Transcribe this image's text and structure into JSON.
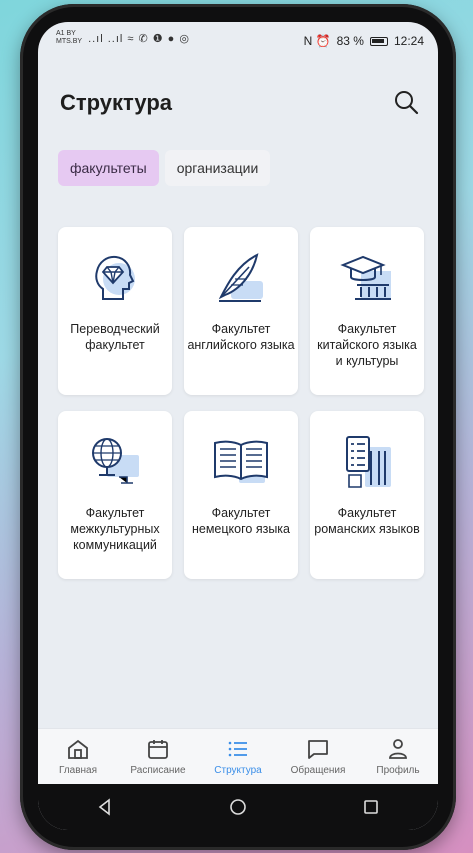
{
  "status": {
    "carrier": "A1 BY\nMTS.BY",
    "left_icons": "..ıl ..ıl ≈ ✆ ❶ ● ◎",
    "battery_percent": "83 %",
    "time": "12:24",
    "right_icons": "N ⏰"
  },
  "header": {
    "title": "Структура"
  },
  "tabs": [
    {
      "label": "факультеты",
      "active": true
    },
    {
      "label": "организации",
      "active": false
    }
  ],
  "faculties": [
    {
      "label": "Переводческий факультет",
      "icon": "head-diamond-icon"
    },
    {
      "label": "Факультет английского языка",
      "icon": "quill-book-icon"
    },
    {
      "label": "Факультет китайского языка и культуры",
      "icon": "graduation-building-icon"
    },
    {
      "label": "Факультет межкультурных коммуникаций",
      "icon": "globe-monitor-icon"
    },
    {
      "label": "Факультет немецкого языка",
      "icon": "open-book-icon"
    },
    {
      "label": "Факультет романских языков",
      "icon": "books-list-icon"
    }
  ],
  "bottom_nav": [
    {
      "label": "Главная",
      "icon": "home-icon",
      "active": false
    },
    {
      "label": "Расписание",
      "icon": "calendar-icon",
      "active": false
    },
    {
      "label": "Структура",
      "icon": "list-icon",
      "active": true
    },
    {
      "label": "Обращения",
      "icon": "chat-icon",
      "active": false
    },
    {
      "label": "Профиль",
      "icon": "profile-icon",
      "active": false
    }
  ],
  "colors": {
    "accent_blue": "#3a8ee8",
    "active_chip": "#e6c9f2",
    "icon_light": "#c8dcf5",
    "icon_stroke": "#1f3a6b"
  }
}
